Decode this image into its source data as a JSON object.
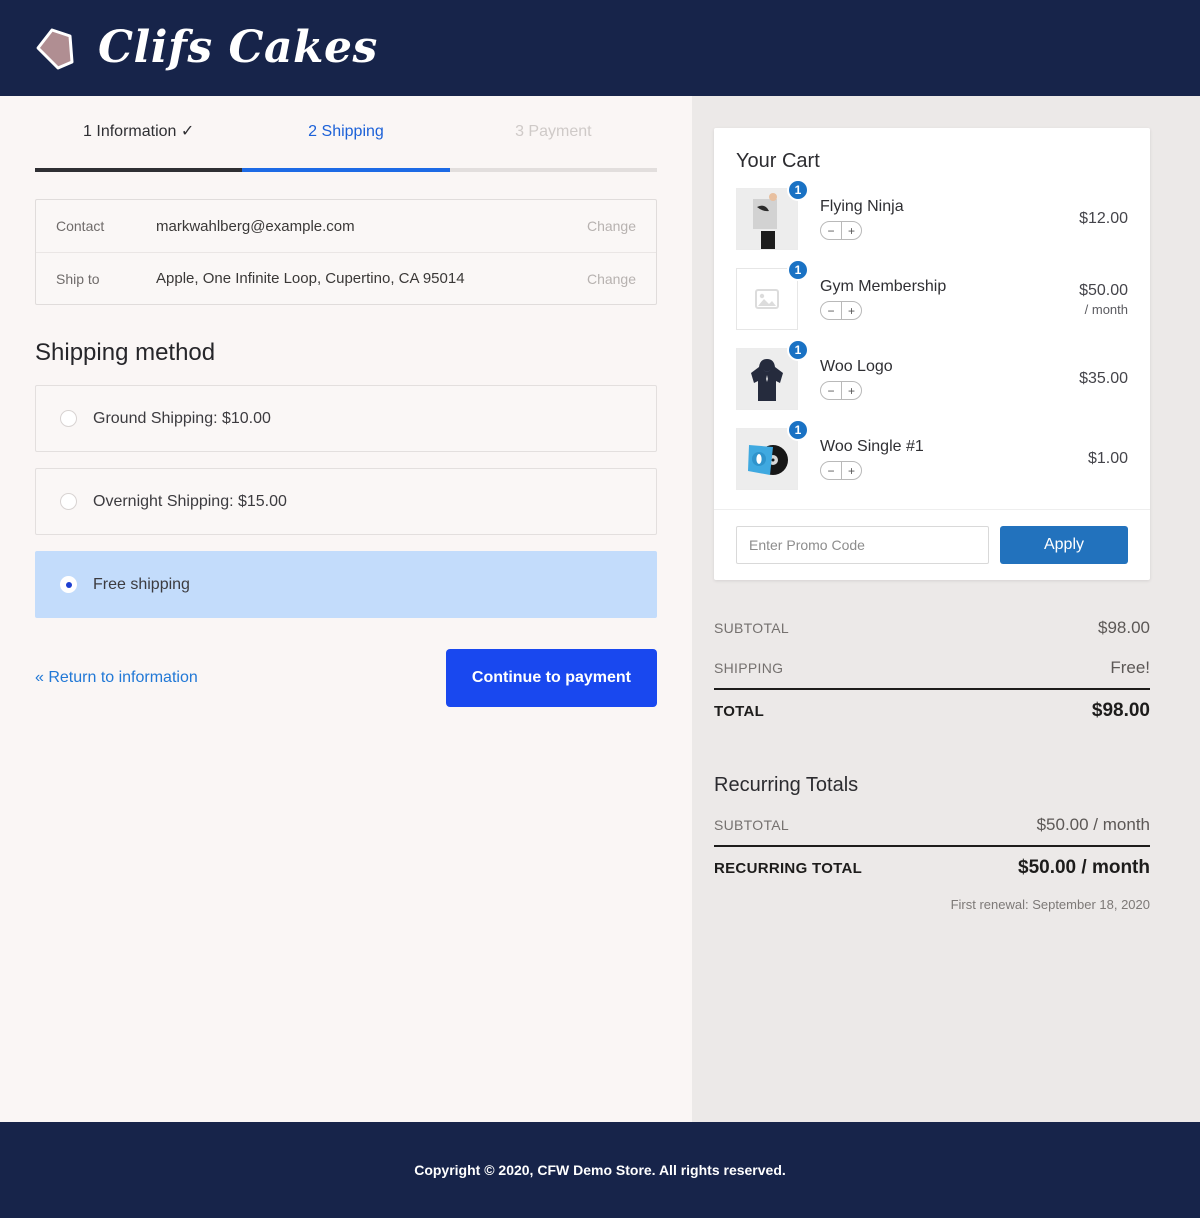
{
  "header": {
    "brand_name": "Clifs Cakes",
    "logo_color": "#b08e92",
    "bar_color": "#17244a"
  },
  "steps": [
    {
      "label": "1 Information ✓",
      "state": "done"
    },
    {
      "label": "2 Shipping",
      "state": "active"
    },
    {
      "label": "3 Payment",
      "state": "pending"
    }
  ],
  "summary": {
    "rows": [
      {
        "label": "Contact",
        "value": "markwahlberg@example.com",
        "change": "Change"
      },
      {
        "label": "Ship to",
        "value": "Apple, One Infinite Loop, Cupertino, CA 95014",
        "change": "Change"
      }
    ]
  },
  "shipping": {
    "title": "Shipping method",
    "options": [
      {
        "label": "Ground Shipping: $10.00",
        "selected": false
      },
      {
        "label": "Overnight Shipping: $15.00",
        "selected": false
      },
      {
        "label": "Free shipping",
        "selected": true
      }
    ]
  },
  "actions": {
    "return_label": "« Return to information",
    "continue_label": "Continue to payment"
  },
  "cart": {
    "title": "Your Cart",
    "items": [
      {
        "name": "Flying Ninja",
        "qty": "1",
        "price": "$12.00",
        "period": "",
        "thumb": "photo-person"
      },
      {
        "name": "Gym Membership",
        "qty": "1",
        "price": "$50.00",
        "period": "/ month",
        "thumb": "placeholder"
      },
      {
        "name": "Woo Logo",
        "qty": "1",
        "price": "$35.00",
        "period": "",
        "thumb": "hoodie"
      },
      {
        "name": "Woo Single #1",
        "qty": "1",
        "price": "$1.00",
        "period": "",
        "thumb": "vinyl"
      }
    ],
    "promo_placeholder": "Enter Promo Code",
    "promo_value": "",
    "apply_label": "Apply"
  },
  "totals": {
    "subtotal_label": "SUBTOTAL",
    "subtotal_value": "$98.00",
    "shipping_label": "SHIPPING",
    "shipping_value": "Free!",
    "total_label": "TOTAL",
    "total_value": "$98.00"
  },
  "recurring": {
    "title": "Recurring Totals",
    "subtotal_label": "SUBTOTAL",
    "subtotal_value": "$50.00 / month",
    "total_label": "RECURRING TOTAL",
    "total_value": "$50.00 / month",
    "renewal_note": "First renewal: September 18, 2020"
  },
  "footer": {
    "text": "Copyright © 2020, CFW Demo Store. All rights reserved."
  },
  "stepper": {
    "minus": "−",
    "plus": "+"
  }
}
